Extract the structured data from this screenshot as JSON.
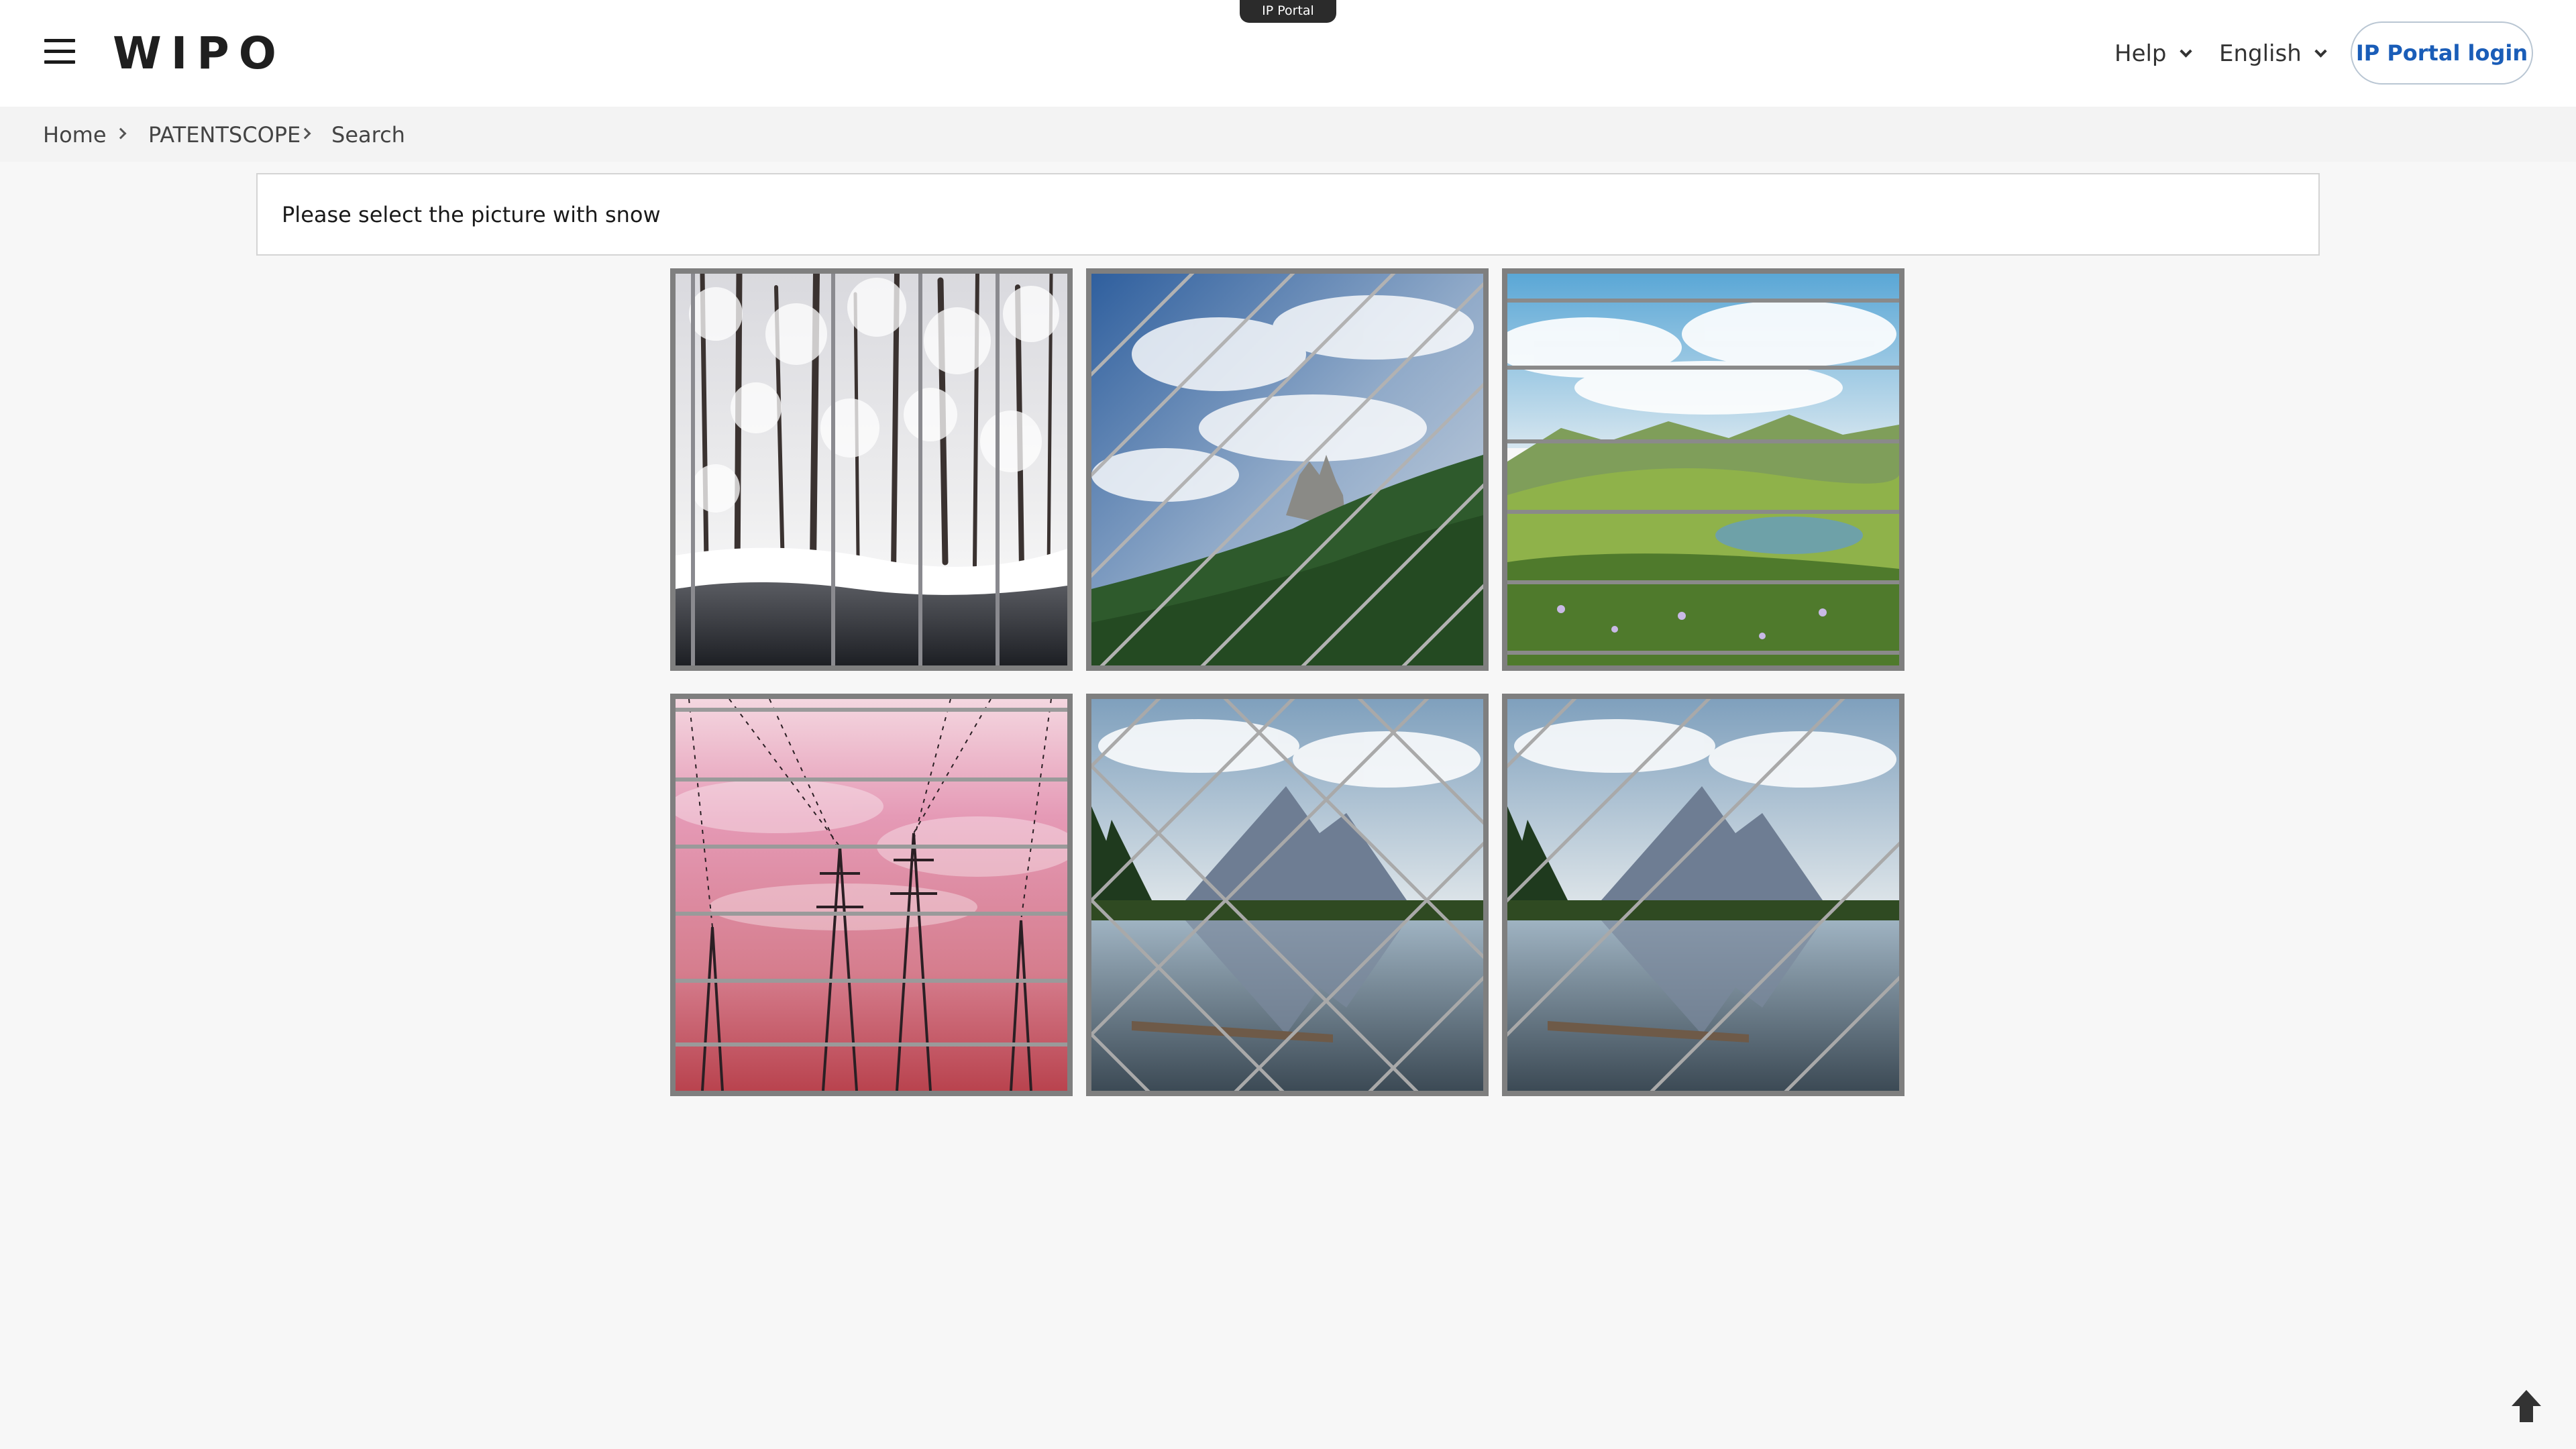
{
  "header": {
    "logo": "WIPO",
    "portal_tab": "IP Portal",
    "help_label": "Help",
    "language_label": "English",
    "login_label": "IP Portal login"
  },
  "breadcrumb": [
    "Home",
    "PATENTSCOPE",
    "Search"
  ],
  "captcha": {
    "prompt": "Please select the picture with snow",
    "tiles": [
      {
        "scene": "snowy-forest",
        "overlay": "vertical-lines"
      },
      {
        "scene": "mountain-castle-sky",
        "overlay": "diagonal-lines"
      },
      {
        "scene": "green-valley-lake",
        "overlay": "horizontal-lines"
      },
      {
        "scene": "power-lines-pink-sky",
        "overlay": "horizontal-lines"
      },
      {
        "scene": "mountain-lake-reflection",
        "overlay": "crosshatch"
      },
      {
        "scene": "mountain-lake-reflection",
        "overlay": "diagonal-lines"
      }
    ]
  },
  "icons": {
    "menu": "hamburger-menu-icon",
    "scroll": "arrow-up-icon"
  },
  "colors": {
    "login_text": "#1a5db8",
    "tile_border": "#7f7f7f",
    "page_background": "#f7f7f7"
  }
}
